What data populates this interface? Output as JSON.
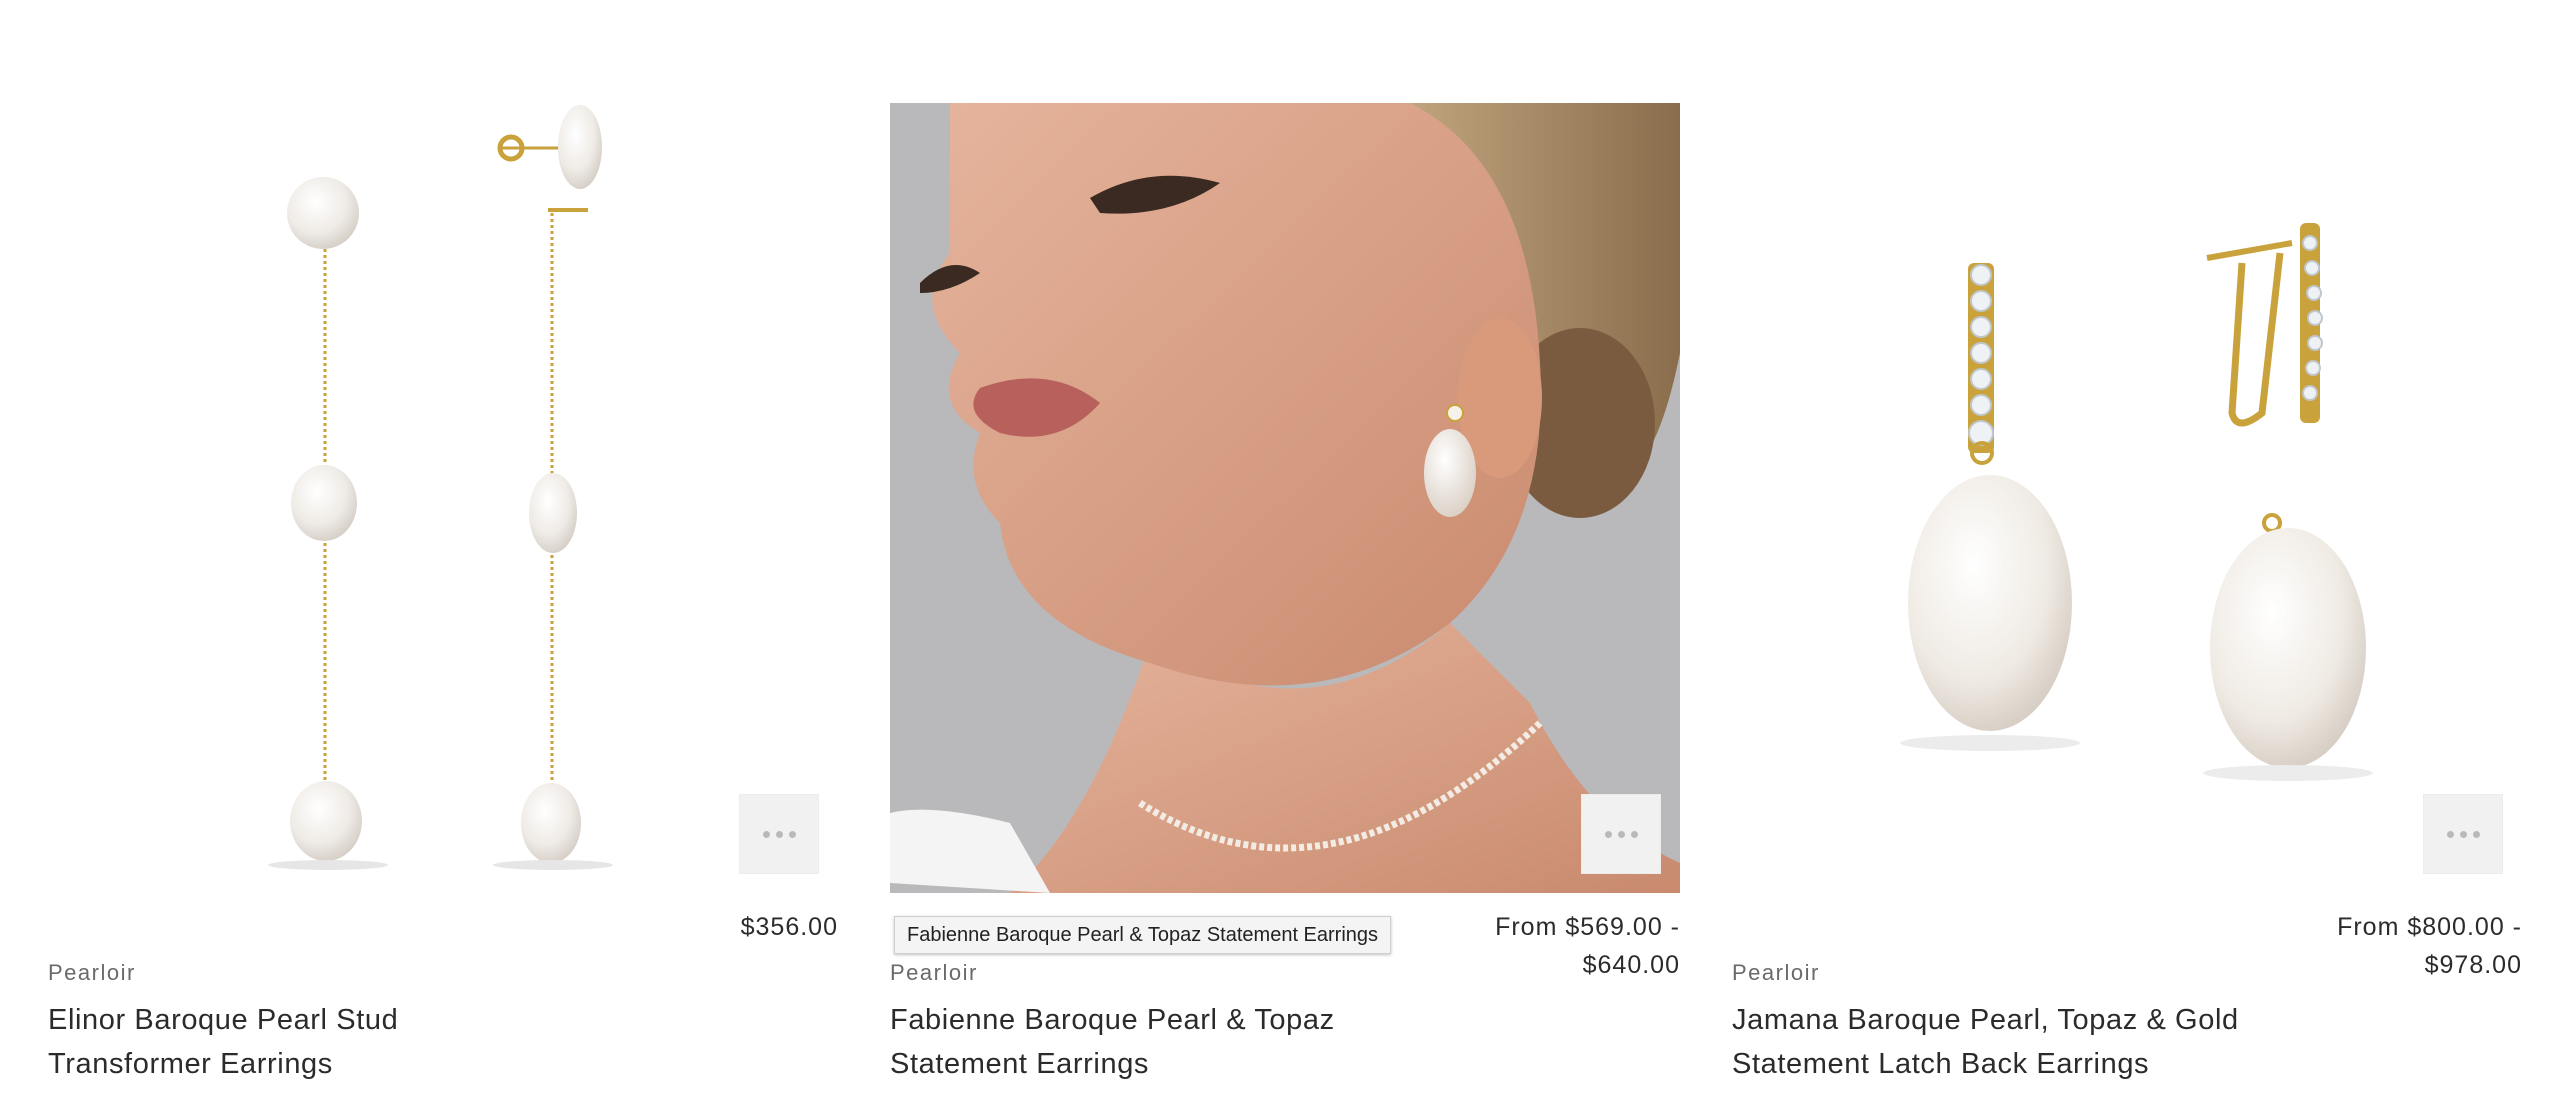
{
  "products": [
    {
      "vendor": "Pearloir",
      "title_line1": "Elinor Baroque Pearl Stud",
      "title_line2": "Transformer Earrings",
      "price_line1": "$356.00",
      "price_line2": "",
      "image": "pearl-drop-chain-earrings-image"
    },
    {
      "vendor": "Pearloir",
      "title_line1": "Fabienne Baroque Pearl & Topaz",
      "title_line2": "Statement Earrings",
      "price_line1": "From $569.00 -",
      "price_line2": "$640.00",
      "image": "model-wearing-pearl-earring-image"
    },
    {
      "vendor": "Pearloir",
      "title_line1": "Jamana Baroque Pearl, Topaz & Gold",
      "title_line2": "Statement Latch Back Earrings",
      "price_line1": "From $800.00 -",
      "price_line2": "$978.00",
      "image": "latch-back-pearl-earrings-image"
    }
  ],
  "tooltip": "Fabienne Baroque Pearl & Topaz Statement Earrings",
  "more_icon": "more-dots-icon",
  "colors": {
    "gold": "#c9a23c",
    "pearl": "#f3efe9",
    "model_bg": "#b9b9bb"
  }
}
